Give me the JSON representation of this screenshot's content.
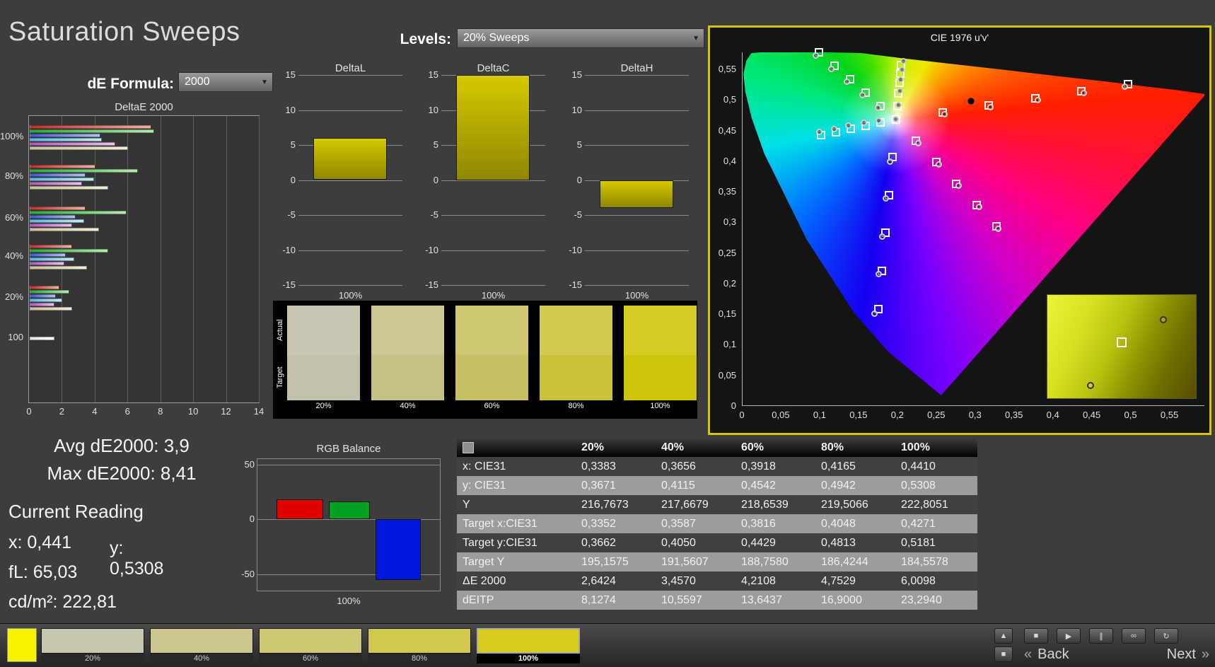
{
  "app": {
    "title": "Saturation Sweeps"
  },
  "controls": {
    "de_formula_label": "dE Formula:",
    "de_formula_value": "2000",
    "levels_label": "Levels:",
    "levels_value": "20% Sweeps"
  },
  "summary": {
    "avg_label": "Avg dE2000:",
    "avg_value": "3,9",
    "max_label": "Max dE2000:",
    "max_value": "8,41"
  },
  "current": {
    "title": "Current Reading",
    "x_label": "x:",
    "x_value": "0,441",
    "y_label": "y:",
    "y_value": "0,5308",
    "fl_label": "fL:",
    "fl_value": "65,03",
    "lum_label": "cd/m²:",
    "lum_value": "222,81"
  },
  "patch_strip": {
    "row_labels": [
      "Actual",
      "Target"
    ],
    "columns": [
      {
        "label": "20%",
        "actual": "#c9c7b3",
        "target": "#c3c1ab"
      },
      {
        "label": "40%",
        "actual": "#cbc893",
        "target": "#c5c185"
      },
      {
        "label": "60%",
        "actual": "#cec873",
        "target": "#c8c163"
      },
      {
        "label": "80%",
        "actual": "#d1c950",
        "target": "#cbc23c"
      },
      {
        "label": "100%",
        "actual": "#d5cb25",
        "target": "#cfc40a"
      }
    ]
  },
  "table": {
    "columns": [
      "20%",
      "40%",
      "60%",
      "80%",
      "100%"
    ],
    "rows": [
      {
        "label": "x: CIE31",
        "values": [
          "0,3383",
          "0,3656",
          "0,3918",
          "0,4165",
          "0,4410"
        ]
      },
      {
        "label": "y: CIE31",
        "values": [
          "0,3671",
          "0,4115",
          "0,4542",
          "0,4942",
          "0,5308"
        ]
      },
      {
        "label": "Y",
        "values": [
          "216,7673",
          "217,6679",
          "218,6539",
          "219,5066",
          "222,8051"
        ]
      },
      {
        "label": "Target x:CIE31",
        "values": [
          "0,3352",
          "0,3587",
          "0,3816",
          "0,4048",
          "0,4271"
        ]
      },
      {
        "label": "Target y:CIE31",
        "values": [
          "0,3662",
          "0,4050",
          "0,4429",
          "0,4813",
          "0,5181"
        ]
      },
      {
        "label": "Target Y",
        "values": [
          "195,1575",
          "191,5607",
          "188,7580",
          "186,4244",
          "184,5578"
        ]
      },
      {
        "label": "ΔE 2000",
        "values": [
          "2,6424",
          "3,4570",
          "4,2108",
          "4,7529",
          "6,0098"
        ]
      },
      {
        "label": "dEITP",
        "values": [
          "8,1274",
          "10,5597",
          "13,6437",
          "16,9000",
          "23,2940"
        ]
      }
    ]
  },
  "chart_data": [
    {
      "id": "deltae-2000",
      "type": "bar",
      "orientation": "horizontal",
      "title": "DeltaE 2000",
      "xlim": [
        0,
        14
      ],
      "xticks": [
        "0",
        "2",
        "4",
        "6",
        "8",
        "10",
        "12",
        "14"
      ],
      "categories": [
        "100%",
        "80%",
        "60%",
        "40%",
        "20%",
        "100"
      ],
      "series": [
        {
          "name": "red",
          "color": "#c03030",
          "color2": "#eab3a3",
          "values": [
            7.4,
            4.0,
            3.4,
            2.6,
            1.8,
            null
          ]
        },
        {
          "name": "green",
          "color": "#28a838",
          "color2": "#b9e9b1",
          "values": [
            7.6,
            6.6,
            5.9,
            4.8,
            2.4,
            null
          ]
        },
        {
          "name": "blue",
          "color": "#4858d0",
          "color2": "#b2c2ea",
          "values": [
            4.3,
            3.4,
            2.8,
            2.2,
            1.6,
            null
          ]
        },
        {
          "name": "cyan",
          "color": "#58b8d8",
          "color2": "#c9e9f1",
          "values": [
            4.4,
            3.9,
            3.3,
            2.7,
            2.0,
            null
          ]
        },
        {
          "name": "magenta",
          "color": "#b058b8",
          "color2": "#eac2ea",
          "values": [
            5.2,
            3.2,
            2.6,
            2.1,
            1.5,
            null
          ]
        },
        {
          "name": "yellow",
          "color": "#c8c098",
          "color2": "#f1edd9",
          "values": [
            6.0,
            4.8,
            4.2,
            3.5,
            2.6,
            null
          ]
        },
        {
          "name": "white",
          "color": "#e8e8e8",
          "color2": "#ffffff",
          "values": [
            null,
            null,
            null,
            null,
            null,
            1.5
          ]
        }
      ],
      "note": "bar lengths estimated from pixels"
    },
    {
      "id": "delta-l",
      "type": "bar",
      "title": "DeltaL",
      "categories": [
        "100%"
      ],
      "values": [
        6
      ],
      "ylim": [
        -15,
        15
      ],
      "yticks": [
        "15",
        "10",
        "5",
        "0",
        "-5",
        "-10",
        "-15"
      ],
      "xlabel": "100%"
    },
    {
      "id": "delta-c",
      "type": "bar",
      "title": "DeltaC",
      "categories": [
        "100%"
      ],
      "values": [
        15
      ],
      "ylim": [
        -15,
        15
      ],
      "yticks": [
        "15",
        "10",
        "5",
        "0",
        "-5",
        "-10",
        "-15"
      ],
      "xlabel": "100%"
    },
    {
      "id": "delta-h",
      "type": "bar",
      "title": "DeltaH",
      "categories": [
        "100%"
      ],
      "values": [
        -4
      ],
      "ylim": [
        -15,
        15
      ],
      "yticks": [
        "15",
        "10",
        "5",
        "0",
        "-5",
        "-10",
        "-15"
      ],
      "xlabel": "100%"
    },
    {
      "id": "rgb-balance",
      "type": "bar",
      "title": "RGB Balance",
      "categories": [
        "Red",
        "Green",
        "Blue"
      ],
      "values": [
        18,
        16,
        -55
      ],
      "colors": [
        "#e00000",
        "#00a020",
        "#0018dd"
      ],
      "ylim": [
        -65,
        55
      ],
      "yticks": [
        "50",
        "0",
        "-50"
      ],
      "xlabel": "100%",
      "note": "values estimated from pixels"
    },
    {
      "id": "cie-1976",
      "type": "scatter",
      "title": "CIE 1976 u'v'",
      "xlim": [
        0,
        0.595
      ],
      "ylim": [
        0,
        0.578
      ],
      "xticks": [
        "0",
        "0,05",
        "0,1",
        "0,15",
        "0,2",
        "0,25",
        "0,3",
        "0,35",
        "0,4",
        "0,45",
        "0,5",
        "0,55"
      ],
      "yticks": [
        "0",
        "0,05",
        "0,1",
        "0,15",
        "0,2",
        "0,25",
        "0,3",
        "0,35",
        "0,4",
        "0,45",
        "0,5",
        "0,55"
      ],
      "series": [
        {
          "name": "target-red",
          "marker": "square",
          "points": [
            [
              0.2575,
              0.4797
            ],
            [
              0.3172,
              0.4912
            ],
            [
              0.377,
              0.5026
            ],
            [
              0.4367,
              0.5141
            ],
            [
              0.4964,
              0.5255
            ]
          ]
        },
        {
          "name": "measured-red",
          "marker": "circle",
          "points": [
            [
              0.261,
              0.476
            ],
            [
              0.32,
              0.488
            ],
            [
              0.381,
              0.4995
            ],
            [
              0.44,
              0.5105
            ],
            [
              0.493,
              0.5215
            ]
          ]
        },
        {
          "name": "target-green",
          "marker": "square",
          "points": [
            [
              0.178,
              0.4902
            ],
            [
              0.1581,
              0.5121
            ],
            [
              0.1383,
              0.5339
            ],
            [
              0.1184,
              0.5558
            ],
            [
              0.0986,
              0.5777
            ]
          ]
        },
        {
          "name": "measured-green",
          "marker": "circle",
          "points": [
            [
              0.175,
              0.486
            ],
            [
              0.1545,
              0.507
            ],
            [
              0.1345,
              0.529
            ],
            [
              0.115,
              0.55
            ],
            [
              0.095,
              0.572
            ]
          ]
        },
        {
          "name": "target-blue",
          "marker": "square",
          "points": [
            [
              0.1933,
              0.4062
            ],
            [
              0.1888,
              0.3441
            ],
            [
              0.1844,
              0.2821
            ],
            [
              0.1799,
              0.22
            ],
            [
              0.1754,
              0.1579
            ]
          ]
        },
        {
          "name": "measured-blue",
          "marker": "circle",
          "points": [
            [
              0.19,
              0.399
            ],
            [
              0.185,
              0.338
            ],
            [
              0.18,
              0.276
            ],
            [
              0.176,
              0.214
            ],
            [
              0.17,
              0.15
            ]
          ]
        },
        {
          "name": "target-cyan",
          "marker": "square",
          "points": [
            [
              0.178,
              0.463
            ],
            [
              0.159,
              0.458
            ],
            [
              0.139,
              0.453
            ],
            [
              0.12,
              0.447
            ],
            [
              0.101,
              0.442
            ]
          ]
        },
        {
          "name": "measured-cyan",
          "marker": "circle",
          "points": [
            [
              0.176,
              0.466
            ],
            [
              0.157,
              0.462
            ],
            [
              0.137,
              0.457
            ],
            [
              0.118,
              0.452
            ],
            [
              0.099,
              0.447
            ]
          ]
        },
        {
          "name": "target-magenta",
          "marker": "square",
          "points": [
            [
              0.2236,
              0.4332
            ],
            [
              0.2495,
              0.3982
            ],
            [
              0.2753,
              0.3631
            ],
            [
              0.3012,
              0.3281
            ],
            [
              0.327,
              0.293
            ]
          ]
        },
        {
          "name": "measured-magenta",
          "marker": "circle",
          "points": [
            [
              0.227,
              0.429
            ],
            [
              0.253,
              0.394
            ],
            [
              0.279,
              0.359
            ],
            [
              0.305,
              0.324
            ],
            [
              0.33,
              0.289
            ]
          ]
        },
        {
          "name": "target-yellow",
          "marker": "square",
          "points": [
            [
              0.1994,
              0.4901
            ],
            [
              0.2009,
              0.5103
            ],
            [
              0.2021,
              0.5278
            ],
            [
              0.2033,
              0.5438
            ],
            [
              0.2043,
              0.5576
            ]
          ]
        },
        {
          "name": "measured-yellow",
          "marker": "circle",
          "points": [
            [
              0.2011,
              0.491
            ],
            [
              0.2029,
              0.5139
            ],
            [
              0.2044,
              0.5332
            ],
            [
              0.2058,
              0.5493
            ],
            [
              0.2078,
              0.5628
            ]
          ]
        },
        {
          "name": "white-point-target",
          "marker": "square",
          "points": [
            [
              0.1978,
              0.4683
            ]
          ]
        },
        {
          "name": "white-point-measured",
          "marker": "circle",
          "points": [
            [
              0.1978,
              0.4683
            ]
          ]
        },
        {
          "name": "current",
          "marker": "dot",
          "points": [
            [
              0.294,
              0.498
            ]
          ]
        }
      ],
      "inset": {
        "markers": [
          {
            "type": "square",
            "x": 50,
            "y": 46
          },
          {
            "type": "circle",
            "x": 78,
            "y": 24
          },
          {
            "type": "circle",
            "x": 29,
            "y": 88
          }
        ]
      },
      "note": "sweep point positions estimated; yellow sweep derived from table xy values"
    }
  ],
  "taskbar": {
    "current_patch_color": "#f8f400",
    "patches": [
      {
        "label": "20%",
        "color": "#c9c6ae",
        "selected": false
      },
      {
        "label": "40%",
        "color": "#cbc78f",
        "selected": false
      },
      {
        "label": "60%",
        "color": "#cec772",
        "selected": false
      },
      {
        "label": "80%",
        "color": "#d1c84f",
        "selected": false
      },
      {
        "label": "100%",
        "color": "#d8cc1d",
        "selected": true
      }
    ],
    "side_buttons": [
      {
        "name": "scroll-up",
        "glyph": "▲"
      },
      {
        "name": "stop-patch",
        "glyph": "■"
      }
    ],
    "transport": [
      {
        "name": "stop",
        "glyph": "■"
      },
      {
        "name": "play",
        "glyph": "▶"
      },
      {
        "name": "pause",
        "glyph": "∥"
      },
      {
        "name": "loop",
        "glyph": "∞"
      },
      {
        "name": "repeat",
        "glyph": "↻"
      }
    ],
    "nav": {
      "prev_chevron": "«",
      "back": "Back",
      "next": "Next",
      "next_chevron": "»"
    }
  },
  "accent": {
    "panel_border": "#d8c700",
    "bar_fill": "#cfc400"
  }
}
